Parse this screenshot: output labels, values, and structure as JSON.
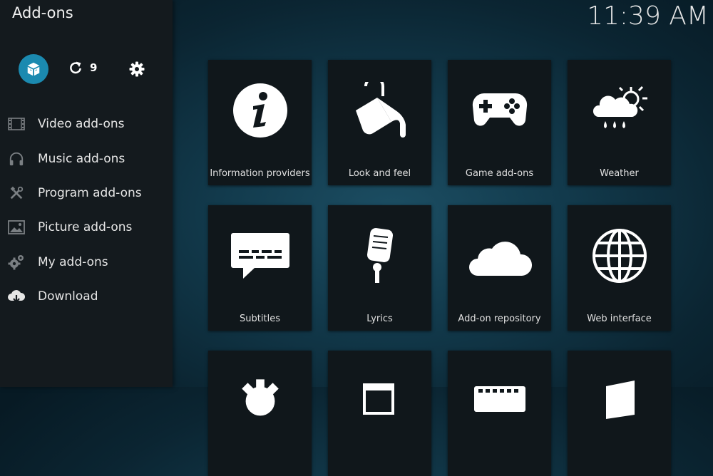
{
  "header": {
    "title": "Add-ons",
    "clock": "11:39 AM"
  },
  "toolbar": {
    "addon_browser_icon": "box-icon",
    "update_count": "9",
    "update_icon": "refresh-icon",
    "settings_icon": "gear-icon",
    "accent_color": "#1b8ab0"
  },
  "sidebar": {
    "items": [
      {
        "label": "Video add-ons",
        "icon": "film-icon"
      },
      {
        "label": "Music add-ons",
        "icon": "headphones-icon"
      },
      {
        "label": "Program add-ons",
        "icon": "tools-icon"
      },
      {
        "label": "Picture add-ons",
        "icon": "picture-icon"
      },
      {
        "label": "My add-ons",
        "icon": "gears-icon"
      },
      {
        "label": "Download",
        "icon": "cloud-download-icon"
      }
    ]
  },
  "grid": {
    "tiles": [
      {
        "label": "Information providers",
        "icon": "info-icon"
      },
      {
        "label": "Look and feel",
        "icon": "paint-bucket-icon"
      },
      {
        "label": "Game add-ons",
        "icon": "gamepad-icon"
      },
      {
        "label": "Weather",
        "icon": "weather-icon"
      },
      {
        "label": "Subtitles",
        "icon": "subtitles-icon"
      },
      {
        "label": "Lyrics",
        "icon": "microphone-icon"
      },
      {
        "label": "Add-on repository",
        "icon": "cloud-icon"
      },
      {
        "label": "Web interface",
        "icon": "globe-icon"
      },
      {
        "label": "",
        "icon": "gear-icon"
      },
      {
        "label": "",
        "icon": "window-icon"
      },
      {
        "label": "",
        "icon": "keyboard-icon"
      },
      {
        "label": "",
        "icon": "screensaver-icon"
      }
    ]
  }
}
